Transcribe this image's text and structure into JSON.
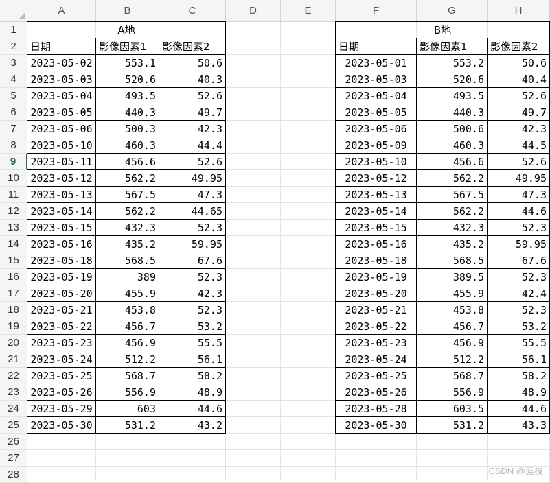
{
  "columns": [
    "A",
    "B",
    "C",
    "D",
    "E",
    "F",
    "G",
    "H"
  ],
  "rows": [
    "1",
    "2",
    "3",
    "4",
    "5",
    "6",
    "7",
    "8",
    "9",
    "10",
    "11",
    "12",
    "13",
    "14",
    "15",
    "16",
    "17",
    "18",
    "19",
    "20",
    "21",
    "22",
    "23",
    "24",
    "25",
    "26",
    "27",
    "28"
  ],
  "active_row": "9",
  "tableA": {
    "title": "A地",
    "headers": [
      "日期",
      "影像因素1",
      "影像因素2"
    ],
    "rows": [
      [
        "2023-05-02",
        "553.1",
        "50.6"
      ],
      [
        "2023-05-03",
        "520.6",
        "40.3"
      ],
      [
        "2023-05-04",
        "493.5",
        "52.6"
      ],
      [
        "2023-05-05",
        "440.3",
        "49.7"
      ],
      [
        "2023-05-06",
        "500.3",
        "42.3"
      ],
      [
        "2023-05-10",
        "460.3",
        "44.4"
      ],
      [
        "2023-05-11",
        "456.6",
        "52.6"
      ],
      [
        "2023-05-12",
        "562.2",
        "49.95"
      ],
      [
        "2023-05-13",
        "567.5",
        "47.3"
      ],
      [
        "2023-05-14",
        "562.2",
        "44.65"
      ],
      [
        "2023-05-15",
        "432.3",
        "52.3"
      ],
      [
        "2023-05-16",
        "435.2",
        "59.95"
      ],
      [
        "2023-05-18",
        "568.5",
        "67.6"
      ],
      [
        "2023-05-19",
        "389",
        "52.3"
      ],
      [
        "2023-05-20",
        "455.9",
        "42.3"
      ],
      [
        "2023-05-21",
        "453.8",
        "52.3"
      ],
      [
        "2023-05-22",
        "456.7",
        "53.2"
      ],
      [
        "2023-05-23",
        "456.9",
        "55.5"
      ],
      [
        "2023-05-24",
        "512.2",
        "56.1"
      ],
      [
        "2023-05-25",
        "568.7",
        "58.2"
      ],
      [
        "2023-05-26",
        "556.9",
        "48.9"
      ],
      [
        "2023-05-29",
        "603",
        "44.6"
      ],
      [
        "2023-05-30",
        "531.2",
        "43.2"
      ]
    ]
  },
  "tableB": {
    "title": "B地",
    "headers": [
      "日期",
      "影像因素1",
      "影像因素2"
    ],
    "rows": [
      [
        "2023-05-01",
        "553.2",
        "50.6"
      ],
      [
        "2023-05-03",
        "520.6",
        "40.4"
      ],
      [
        "2023-05-04",
        "493.5",
        "52.6"
      ],
      [
        "2023-05-05",
        "440.3",
        "49.7"
      ],
      [
        "2023-05-06",
        "500.6",
        "42.3"
      ],
      [
        "2023-05-09",
        "460.3",
        "44.5"
      ],
      [
        "2023-05-10",
        "456.6",
        "52.6"
      ],
      [
        "2023-05-12",
        "562.2",
        "49.95"
      ],
      [
        "2023-05-13",
        "567.5",
        "47.3"
      ],
      [
        "2023-05-14",
        "562.2",
        "44.6"
      ],
      [
        "2023-05-15",
        "432.3",
        "52.3"
      ],
      [
        "2023-05-16",
        "435.2",
        "59.95"
      ],
      [
        "2023-05-18",
        "568.5",
        "67.6"
      ],
      [
        "2023-05-19",
        "389.5",
        "52.3"
      ],
      [
        "2023-05-20",
        "455.9",
        "42.4"
      ],
      [
        "2023-05-21",
        "453.8",
        "52.3"
      ],
      [
        "2023-05-22",
        "456.7",
        "53.2"
      ],
      [
        "2023-05-23",
        "456.9",
        "55.5"
      ],
      [
        "2023-05-24",
        "512.2",
        "56.1"
      ],
      [
        "2023-05-25",
        "568.7",
        "58.2"
      ],
      [
        "2023-05-26",
        "556.9",
        "48.9"
      ],
      [
        "2023-05-28",
        "603.5",
        "44.6"
      ],
      [
        "2023-05-30",
        "531.2",
        "43.3"
      ]
    ]
  },
  "watermark": "CSDN @涯枝"
}
